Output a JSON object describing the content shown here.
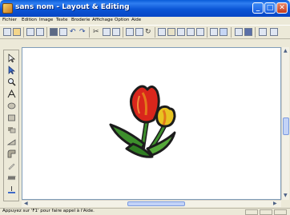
{
  "window": {
    "title": "sans nom - Layout & Editing"
  },
  "title_buttons": {
    "minimize": "_",
    "maximize": "□",
    "close": "✕"
  },
  "menu": {
    "items": [
      {
        "label": "Fichier"
      },
      {
        "label": "Edition"
      },
      {
        "label": "Image"
      },
      {
        "label": "Texte"
      },
      {
        "label": "Broderie"
      },
      {
        "label": "Affichage"
      },
      {
        "label": "Option"
      },
      {
        "label": "Aide"
      }
    ]
  },
  "toolbar": {
    "icons": [
      "new-file-icon",
      "open-file-icon",
      "save-icon",
      "print-icon",
      "cut-icon",
      "copy-icon",
      "paste-icon",
      "undo-icon",
      "redo-icon",
      "zoom-icon",
      "image-icon",
      "stitch-icon",
      "grid-icon",
      "preview-icon",
      "transfer-icon",
      "help-icon"
    ]
  },
  "palette": {
    "tools": [
      "select-arrow-icon",
      "point-edit-icon",
      "zoom-icon",
      "text-icon",
      "ellipse-icon",
      "rectangle-icon",
      "shape-fill-icon",
      "arc-icon",
      "corner-icon",
      "pencil-icon",
      "stitch-pattern-icon",
      "manual-punch-icon"
    ]
  },
  "colors": {
    "petal_red": "#d9261c",
    "petal_orange": "#e2781a",
    "petal_yellow": "#e8c321",
    "leaf_green": "#3d8f2c",
    "outline": "#1c1c1c"
  },
  "status": {
    "message": "Appuyez sur 'F1' pour faire appel à l'Aide."
  }
}
